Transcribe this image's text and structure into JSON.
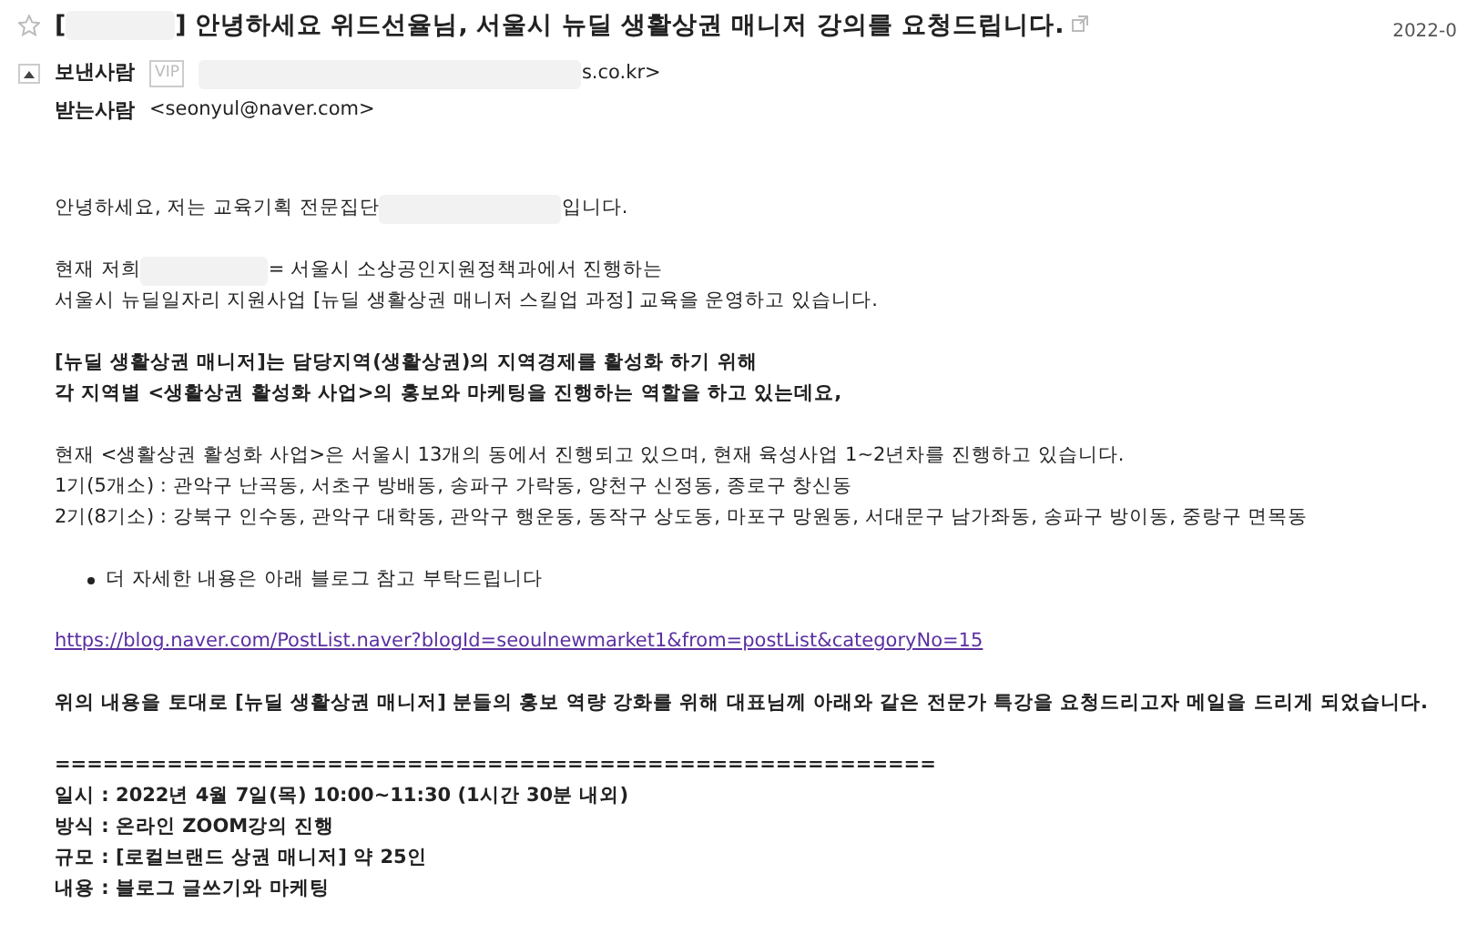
{
  "header": {
    "starred": false,
    "title_prefix": "[",
    "title": "] 안녕하세요 위드선율님, 서울시 뉴딜 생활상권 매니저 강의를 요청드립니다.",
    "date": "2022-0",
    "sender": {
      "label": "보낸사람",
      "badge": "VIP",
      "address": "s.co.kr>",
      "expanded": true
    },
    "recipient": {
      "label": "받는사람",
      "address": "<seonyul@naver.com>"
    }
  },
  "body": [
    {
      "kind": "text",
      "lines": [
        {
          "parts": [
            "안녕하세요, 저는 교육기획 전문집단",
            "입니다."
          ]
        }
      ]
    },
    {
      "kind": "text",
      "lines": [
        {
          "parts": [
            "현재 저희",
            "= 서울시 소상공인지원정책과에서 진행하는"
          ]
        },
        {
          "parts": [
            "서울시 뉴딜일자리 지원사업 [뉴딜 생활상권 매니저 스킬업 과정] 교육을 운영하고 있습니다."
          ]
        }
      ]
    },
    {
      "kind": "bold",
      "lines": [
        {
          "parts": [
            "[뉴딜 생활상권 매니저]는 담당지역(생활상권)의 지역경제를 활성화 하기 위해"
          ]
        },
        {
          "parts": [
            "각 지역별 <생활상권 활성화 사업>의 홍보와 마케팅을 진행하는 역할을 하고 있는데요,"
          ]
        }
      ]
    },
    {
      "kind": "text",
      "lines": [
        {
          "parts": [
            "현재 <생활상권 활성화 사업>은 서울시 13개의 동에서 진행되고 있으며, 현재 육성사업 1~2년차를 진행하고 있습니다."
          ]
        },
        {
          "parts": [
            "1기(5개소) : 관악구 난곡동, 서초구 방배동, 송파구 가락동, 양천구 신정동, 종로구 창신동"
          ]
        },
        {
          "parts": [
            "2기(8기소) : 강북구 인수동, 관악구 대학동, 관악구 행운동, 동작구 상도동, 마포구 망원동, 서대문구 남가좌동, 송파구 방이동, 중랑구 면목동"
          ]
        }
      ]
    },
    {
      "kind": "bullet",
      "lines": [
        {
          "parts": [
            "더 자세한 내용은 아래 블로그 참고 부탁드립니다"
          ]
        }
      ]
    },
    {
      "kind": "link",
      "lines": [
        {
          "parts": [
            "https://blog.naver.com/PostList.naver?blogId=seoulnewmarket1&from=postList&categoryNo=15"
          ]
        }
      ]
    },
    {
      "kind": "bold",
      "lines": [
        {
          "parts": [
            "위의 내용을 토대로 [뉴딜 생활상권 매니저] 분들의 홍보 역량 강화를 위해 대표님께 아래와 같은 전문가 특강을 요청드리고자 메일을 드리게 되었습니다."
          ]
        }
      ]
    },
    {
      "kind": "bold",
      "lines": [
        {
          "parts": [
            "======================================================="
          ]
        },
        {
          "parts": [
            "일시 : 2022년 4월 7일(목) 10:00~11:30 (1시간 30분 내외)"
          ]
        },
        {
          "parts": [
            "방식 : 온라인 ZOOM강의 진행"
          ]
        },
        {
          "parts": [
            "규모 : [로컬브랜드 상권 매니저] 약 25인"
          ]
        },
        {
          "parts": [
            "내용 : 블로그 글쓰기와 마케팅"
          ]
        }
      ]
    }
  ]
}
